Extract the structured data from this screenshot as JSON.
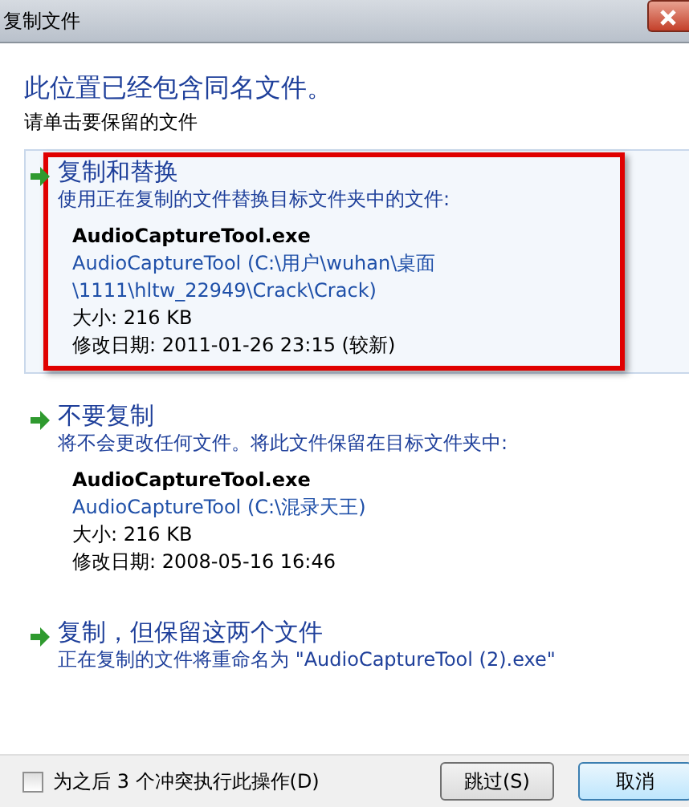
{
  "window": {
    "title": "复制文件"
  },
  "heading": "此位置已经包含同名文件。",
  "instruction": "请单击要保留的文件",
  "options": [
    {
      "title": "复制和替换",
      "description": "使用正在复制的文件替换目标文件夹中的文件:",
      "hovered": true,
      "outlined": true,
      "file": {
        "name": "AudioCaptureTool.exe",
        "path_lines": [
          "AudioCaptureTool (C:\\用户\\wuhan\\桌面",
          "\\1111\\hltw_22949\\Crack\\Crack)"
        ],
        "size": "大小: 216 KB",
        "modified": "修改日期: 2011-01-26 23:15 (较新)"
      }
    },
    {
      "title": "不要复制",
      "description": "将不会更改任何文件。将此文件保留在目标文件夹中:",
      "hovered": false,
      "outlined": false,
      "file": {
        "name": "AudioCaptureTool.exe",
        "path_lines": [
          "AudioCaptureTool (C:\\混录天王)"
        ],
        "size": "大小: 216 KB",
        "modified": "修改日期: 2008-05-16 16:46"
      }
    },
    {
      "title": "复制，但保留这两个文件",
      "description": "正在复制的文件将重命名为 \"AudioCaptureTool (2).exe\"",
      "hovered": false,
      "outlined": false
    }
  ],
  "footer": {
    "checkbox": {
      "label": "为之后 3 个冲突执行此操作(D)",
      "checked": false
    },
    "buttons": [
      {
        "label": "跳过(S)",
        "default": false
      },
      {
        "label": "取消",
        "default": true
      }
    ]
  }
}
